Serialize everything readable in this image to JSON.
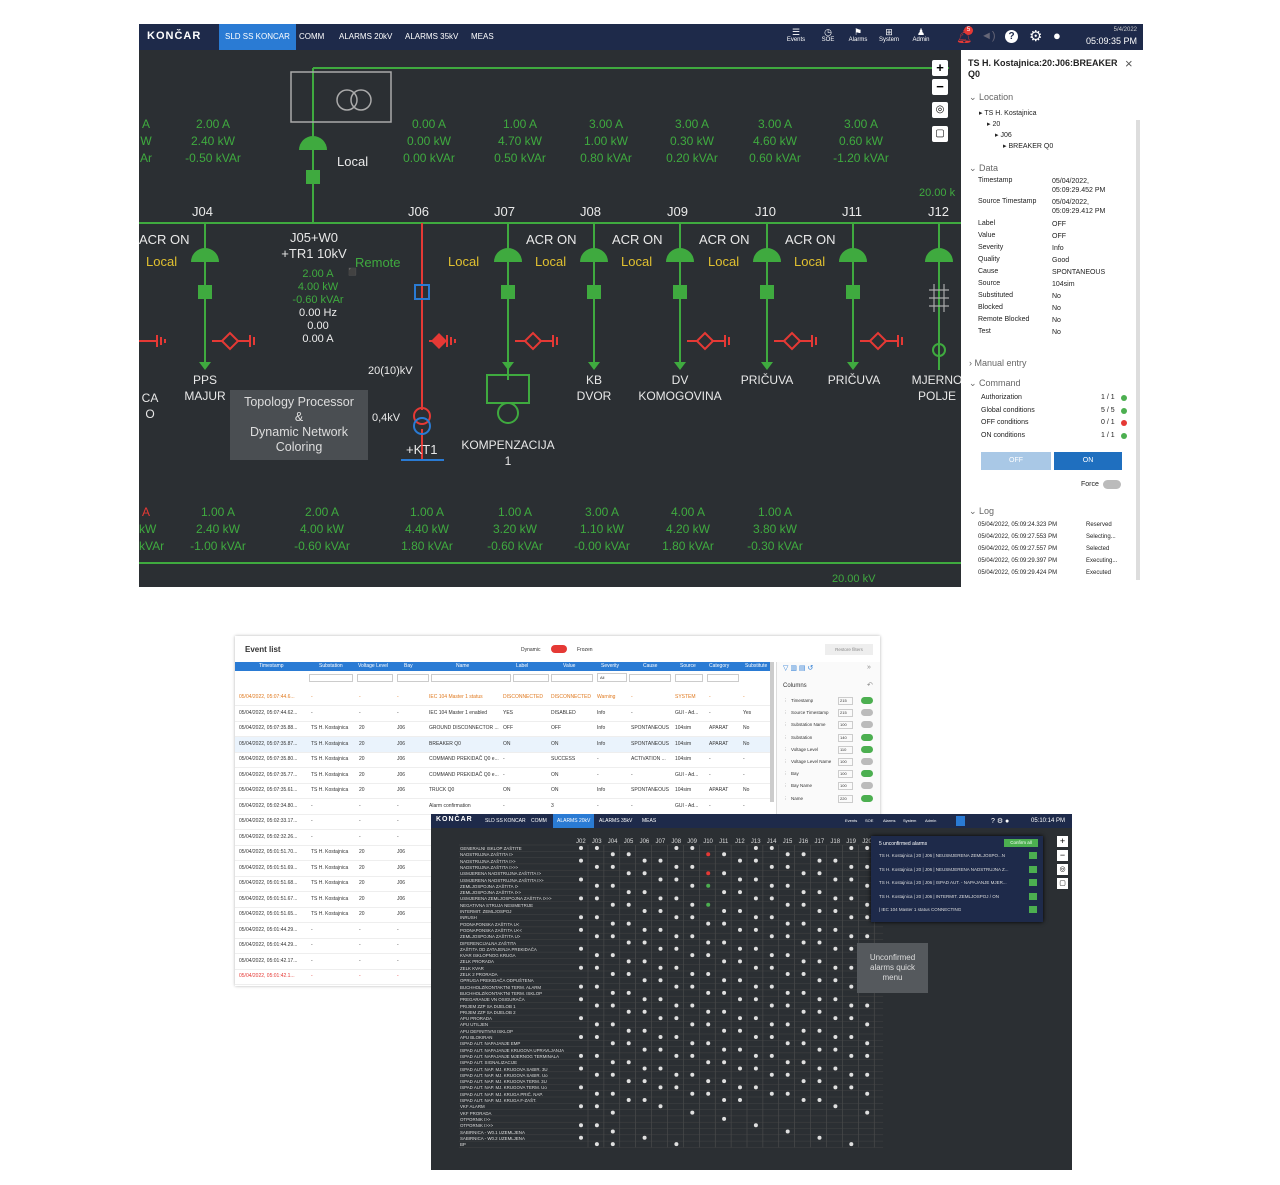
{
  "scada": {
    "logo": "KONČAR",
    "tabs": [
      "SLD SS KONCAR",
      "COMM",
      "ALARMS 20kV",
      "ALARMS 35kV",
      "MEAS"
    ],
    "toolbar_icons": [
      {
        "label": "Events",
        "icon": "events-icon"
      },
      {
        "label": "SOE",
        "icon": "soe-icon"
      },
      {
        "label": "Alarms",
        "icon": "alarms-icon"
      },
      {
        "label": "System",
        "icon": "system-icon"
      },
      {
        "label": "Admin",
        "icon": "admin-icon"
      }
    ],
    "bell_count": "5",
    "date": "5/4/2022",
    "time": "05:09:35 PM",
    "accent": "#2a7bd4",
    "sld_green": "#4caf50",
    "sld_red": "#e53935"
  },
  "sld": {
    "top_meas": [
      {
        "a": "2.00 A",
        "kw": "2.40 kW",
        "kvar": "-0.50 kVAr"
      },
      {
        "a": "0.00 A",
        "kw": "0.00 kW",
        "kvar": "0.00 kVAr"
      },
      {
        "a": "1.00 A",
        "kw": "4.70 kW",
        "kvar": "0.50 kVAr"
      },
      {
        "a": "3.00 A",
        "kw": "1.00 kW",
        "kvar": "0.80 kVAr"
      },
      {
        "a": "3.00 A",
        "kw": "0.30 kW",
        "kvar": "0.20 kVAr"
      },
      {
        "a": "3.00 A",
        "kw": "4.60 kW",
        "kvar": "0.60 kVAr"
      },
      {
        "a": "3.00 A",
        "kw": "0.60 kW",
        "kvar": "-1.20 kVAr"
      }
    ],
    "left_edge_top": [
      "A",
      "W",
      "Ar"
    ],
    "local_label": "Local",
    "bays": [
      "J04",
      "J06",
      "J07",
      "J08",
      "J09",
      "J10",
      "J11",
      "J12"
    ],
    "j05_title": "J05+W0",
    "j05_sub": "+TR1 10kV",
    "j05_meas": [
      "2.00 A",
      "4.00 kW",
      "-0.60 kVAr",
      "0.00 Hz",
      "0.00",
      "0.00 A"
    ],
    "acr_on": "ACR ON",
    "remote": "Remote",
    "bay_names": [
      {
        "name": "PPS",
        "sub": "MAJUR"
      },
      {
        "name": "KB",
        "sub": "DVOR"
      },
      {
        "name": "DV",
        "sub": "KOMOGOVINA"
      },
      {
        "name": "PRIČUVA",
        "sub": ""
      },
      {
        "name": "PRIČUVA",
        "sub": ""
      },
      {
        "name": "MJERNO",
        "sub": "POLJE"
      }
    ],
    "left_names": [
      "CA",
      "O"
    ],
    "tr_label": "20(10)kV",
    "lv_label": "0,4kV",
    "kt1": "+KT1",
    "komp": "KOMPENZACIJA",
    "komp_num": "1",
    "topology_note": [
      "Topology Processor",
      "&",
      "Dynamic Network",
      "Coloring"
    ],
    "bottom_meas": [
      {
        "a": "1.00 A",
        "kw": "2.40 kW",
        "kvar": "-1.00 kVAr"
      },
      {
        "a": "2.00 A",
        "kw": "4.00 kW",
        "kvar": "-0.60 kVAr"
      },
      {
        "a": "1.00 A",
        "kw": "4.40 kW",
        "kvar": "1.80 kVAr"
      },
      {
        "a": "1.00 A",
        "kw": "3.20 kW",
        "kvar": "-0.60 kVAr"
      },
      {
        "a": "3.00 A",
        "kw": "1.10 kW",
        "kvar": "-0.00 kVAr"
      },
      {
        "a": "4.00 A",
        "kw": "4.20 kW",
        "kvar": "1.80 kVAr"
      },
      {
        "a": "1.00 A",
        "kw": "3.80 kW",
        "kvar": "-0.30 kVAr"
      }
    ],
    "left_edge_bottom": [
      "A",
      "kW",
      "kVAr"
    ],
    "kv_top": "20.00 k",
    "kv_bottom": "20.00 kV"
  },
  "panel": {
    "title": "TS H. Kostajnica:20:J06:BREAKER Q0",
    "location_label": "Location",
    "tree": [
      "TS H. Kostajnica",
      "20",
      "J06",
      "BREAKER Q0"
    ],
    "data_label": "Data",
    "rows": [
      {
        "k": "Timestamp",
        "v": "05/04/2022, 05:09:29.452 PM"
      },
      {
        "k": "Source Timestamp",
        "v": "05/04/2022, 05:09:29.412 PM"
      },
      {
        "k": "Label",
        "v": "OFF"
      },
      {
        "k": "Value",
        "v": "OFF"
      },
      {
        "k": "Severity",
        "v": "Info"
      },
      {
        "k": "Quality",
        "v": "Good"
      },
      {
        "k": "Cause",
        "v": "SPONTANEOUS"
      },
      {
        "k": "Source",
        "v": "104sim"
      },
      {
        "k": "Substituted",
        "v": "No"
      },
      {
        "k": "Blocked",
        "v": "No"
      },
      {
        "k": "Remote Blocked",
        "v": "No"
      },
      {
        "k": "Test",
        "v": "No"
      }
    ],
    "manual_entry": "Manual entry",
    "command_label": "Command",
    "conditions": [
      {
        "k": "Authorization",
        "v": "1 / 1",
        "ok": "#4caf50"
      },
      {
        "k": "Global conditions",
        "v": "5 / 5",
        "ok": "#4caf50"
      },
      {
        "k": "OFF conditions",
        "v": "0 / 1",
        "ok": "#e53935"
      },
      {
        "k": "ON conditions",
        "v": "1 / 1",
        "ok": "#4caf50"
      }
    ],
    "off_btn": "OFF",
    "on_btn": "ON",
    "force_label": "Force",
    "log_label": "Log",
    "log": [
      {
        "t": "05/04/2022, 05:09:24.323 PM",
        "s": "Reserved"
      },
      {
        "t": "05/04/2022, 05:09:27.553 PM",
        "s": "Selecting..."
      },
      {
        "t": "05/04/2022, 05:09:27.557 PM",
        "s": "Selected"
      },
      {
        "t": "05/04/2022, 05:09:29.397 PM",
        "s": "Executing..."
      },
      {
        "t": "05/04/2022, 05:09:29.424 PM",
        "s": "Executed"
      }
    ]
  },
  "events": {
    "title": "Event list",
    "dynamic": "Dynamic",
    "frozen": "Frozen",
    "reset_btn": "Restore filters",
    "columns": [
      "Timestamp",
      "Substation",
      "Voltage Level",
      "Bay",
      "Name",
      "Label",
      "Value",
      "Severity",
      "Cause",
      "Source",
      "Category",
      "Substitute"
    ],
    "filter_all": "All",
    "rows": [
      [
        "05/04/2022, 05:07:44.6...",
        "-",
        "-",
        "-",
        "IEC 104 Master 1 status",
        "DISCONNECTED",
        "DISCONNECTED",
        "Warning",
        "-",
        "SYSTEM",
        "-",
        "-"
      ],
      [
        "05/04/2022, 05:07:44.62...",
        "-",
        "-",
        "-",
        "IEC 104 Master 1 enabled",
        "YES",
        "DISABLED",
        "Info",
        "-",
        "GUI - Ad...",
        "-",
        "Yes"
      ],
      [
        "05/04/2022, 05:07:35.88...",
        "TS H. Kostajnica",
        "20",
        "J06",
        "GROUND DISCONNECTOR ...",
        "OFF",
        "OFF",
        "Info",
        "SPONTANEOUS",
        "104sim",
        "APARAT",
        "No"
      ],
      [
        "05/04/2022, 05:07:35.87...",
        "TS H. Kostajnica",
        "20",
        "J06",
        "BREAKER Q0",
        "ON",
        "ON",
        "Info",
        "SPONTANEOUS",
        "104sim",
        "APARAT",
        "No"
      ],
      [
        "05/04/2022, 05:07:35.80...",
        "TS H. Kostajnica",
        "20",
        "J06",
        "COMMAND PREKIDAČ Q0 e...",
        "-",
        "SUCCESS",
        "-",
        "ACTIVATION ...",
        "104sim",
        "-",
        "-"
      ],
      [
        "05/04/2022, 05:07:35.77...",
        "TS H. Kostajnica",
        "20",
        "J06",
        "COMMAND PREKIDAČ Q0 e...",
        "-",
        "ON",
        "-",
        "-",
        "GUI - Ad...",
        "-",
        "-"
      ],
      [
        "05/04/2022, 05:07:35.61...",
        "TS H. Kostajnica",
        "20",
        "J06",
        "TRUCK Q0",
        "ON",
        "ON",
        "Info",
        "SPONTANEOUS",
        "104sim",
        "APARAT",
        "No"
      ],
      [
        "05/04/2022, 05:02:34.80...",
        "-",
        "-",
        "-",
        "Alarm confirmation",
        "-",
        "3",
        "-",
        "-",
        "GUI - Ad...",
        "-",
        "-"
      ],
      [
        "05/04/2022, 05:02:33.17...",
        "-",
        "-",
        "-",
        "",
        "",
        "",
        "",
        "",
        "",
        "",
        ""
      ],
      [
        "05/04/2022, 05:02:32.26...",
        "-",
        "-",
        "-",
        "",
        "",
        "",
        "",
        "",
        "",
        "",
        ""
      ],
      [
        "05/04/2022, 05:01:51.70...",
        "TS H. Kostajnica",
        "20",
        "J06",
        "",
        "",
        "",
        "",
        "",
        "",
        "",
        ""
      ],
      [
        "05/04/2022, 05:01:51.69...",
        "TS H. Kostajnica",
        "20",
        "J06",
        "",
        "",
        "",
        "",
        "",
        "",
        "",
        ""
      ],
      [
        "05/04/2022, 05:01:51.68...",
        "TS H. Kostajnica",
        "20",
        "J06",
        "",
        "",
        "",
        "",
        "",
        "",
        "",
        ""
      ],
      [
        "05/04/2022, 05:01:51.67...",
        "TS H. Kostajnica",
        "20",
        "J06",
        "",
        "",
        "",
        "",
        "",
        "",
        "",
        ""
      ],
      [
        "05/04/2022, 05:01:51.65...",
        "TS H. Kostajnica",
        "20",
        "J06",
        "",
        "",
        "",
        "",
        "",
        "",
        "",
        ""
      ],
      [
        "05/04/2022, 05:01:44.29...",
        "-",
        "-",
        "-",
        "",
        "",
        "",
        "",
        "",
        "",
        "",
        ""
      ],
      [
        "05/04/2022, 05:01:44.29...",
        "-",
        "-",
        "-",
        "",
        "",
        "",
        "",
        "",
        "",
        "",
        ""
      ],
      [
        "05/04/2022, 05:01:42.17...",
        "-",
        "-",
        "-",
        "",
        "",
        "",
        "",
        "",
        "",
        "",
        ""
      ],
      [
        "05/04/2022, 05:01:42.1...",
        "-",
        "-",
        "-",
        "",
        "",
        "",
        "",
        "",
        "",
        "",
        ""
      ]
    ],
    "columns_panel_title": "Columns",
    "column_settings": [
      {
        "name": "Timestamp",
        "w": "215",
        "on": true
      },
      {
        "name": "Source Timestamp",
        "w": "215",
        "on": false
      },
      {
        "name": "Substation Name",
        "w": "100",
        "on": false
      },
      {
        "name": "Substation",
        "w": "140",
        "on": true
      },
      {
        "name": "Voltage Level",
        "w": "110",
        "on": true
      },
      {
        "name": "Voltage Level Name",
        "w": "100",
        "on": false
      },
      {
        "name": "Bay",
        "w": "100",
        "on": true
      },
      {
        "name": "Bay Name",
        "w": "100",
        "on": false
      },
      {
        "name": "Name",
        "w": "220",
        "on": true
      }
    ]
  },
  "alarms": {
    "logo": "KONČAR",
    "tabs": [
      "SLD SS KONCAR",
      "COMM",
      "ALARMS 20kV",
      "ALARMS 35kV",
      "MEAS"
    ],
    "toolbar_icons": [
      "Events",
      "SOE",
      "Alarms",
      "System",
      "Admin"
    ],
    "time": "05:10:14 PM",
    "columns": [
      "J02",
      "J03",
      "J04",
      "J05",
      "J06",
      "J07",
      "J08",
      "J09",
      "J10",
      "J11",
      "J12",
      "J13",
      "J14",
      "J15",
      "J16",
      "J17",
      "J18",
      "J19",
      "J20"
    ],
    "row_labels": [
      "GENERALNI ISKLOP ZAŠTITE",
      "NADSTRUJNA ZAŠTITA I>",
      "NADSTRUJNA ZAŠTITA I>>",
      "NADSTRUJNA ZAŠTITA I>>>",
      "USMJERENA NADSTRUJNA ZAŠTITA I>",
      "USMJERENA NADSTRUJNA ZAŠTITA I>>",
      "ZEMLJOSPOJNA ZAŠTITA I>",
      "ZEMLJOSPOJNA ZAŠTITA I>>",
      "USMJERENA ZEMLJOSPOJNA ZAŠTITA I>>>",
      "NEGATIVNA STRUJA NESIMETRIJE",
      "INTERMIT. ZEMLJOSPOJ",
      "INRUSH",
      "PODNAPONSKA ZAŠTITA U<",
      "PODNAPONSKA ZAŠTITA U<<",
      "ZEMLJOSPOJNA ZAŠTITA U>",
      "DIFERENCIJALNA ZAŠTITA",
      "ZAŠTITA OD ZATAJENJA PREKIDAČA",
      "KVAR ISKLOPNOG KRUGA",
      "ZELK PRORADA",
      "ZELK KVAR",
      "ZELK 2 PRORADA",
      "OPRUGA PREKIDAČA ODPUŠTENA",
      "BUCHHOLZ/KONTAKTNI TERM. ALARM",
      "BUCHHOLZ/KONTAKTNI TERM. ISKLOP",
      "PREGARANJE VN OSIGURAČA",
      "PRIJEM ZZP SA DIJELOB 1",
      "PRIJEM ZZP SA DIJELOB 2",
      "APU PRORADA",
      "APU UTILJEN",
      "APU DEFINITIVNI ISKLOP",
      "APU BLOKIRAN",
      "ISPAD AUT. NAPAJANJE EMP",
      "ISPAD AUT. NAPAJANJE KRUGOVA UPRAVLJANJA",
      "ISPAD AUT. NAPAJANJE MJERNOG TERMINALA",
      "ISPAD AUT. SIGNALIZACIJE",
      "ISPAD AUT. NAP. MJ. KRUGOVA SABIR. 3U",
      "ISPAD AUT. NAP. MJ. KRUGOVA SABIR. Uo",
      "ISPAD AUT. NAP. MJ. KRUGOVA TERM. 3U",
      "ISPAD AUT. NAP. MJ. KRUGOVA TERM. Uo",
      "ISPAD AUT. NAP. MJ. KRUGA PRIČ. NAP.",
      "ISPAD AUT. NAP. MJ. KRUGA F-ZAŠT.",
      "VKF ALARM",
      "VKF PRORADA",
      "OTPORNIK I>>",
      "OTPORNIK I>>>",
      "SABIRNICA - W0.1 UZEMLJENA",
      "SABIRNICA - W0.2 UZEMLJENA",
      "BP"
    ],
    "note": [
      "Unconfirmed",
      "alarms quick",
      "menu"
    ],
    "unconfirmed_title": "5 unconfirmed alarms",
    "confirm_all": "Confirm all",
    "unconfirmed": [
      "TS H. Kostajnica | 20 | J06 | NEUSMJERENA ZEMLJOSPO...N",
      "TS H. Kostajnica | 20 | J06 | NEUSMJERENA NADSTRUJNA Z...",
      "TS H. Kostajnica | 20 | J06 | ISPAD AUT. - NAPAJANJE MJER...",
      "TS H. Kostajnica | 20 | J06 | INTERMIT. ZEMLJOSPOJ / ON",
      "| IEC 104 Master 1 status CONNECTING"
    ]
  }
}
